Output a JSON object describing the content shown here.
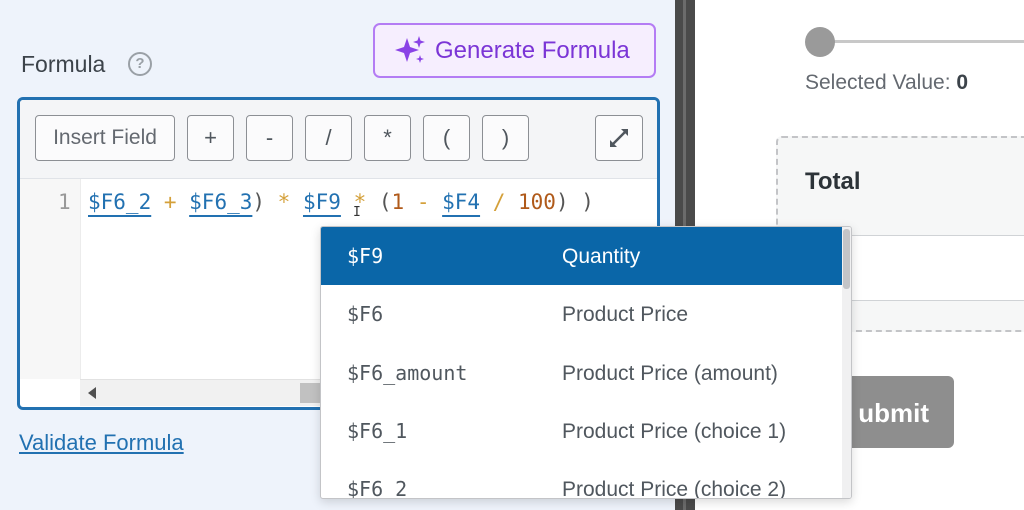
{
  "formula": {
    "label": "Formula",
    "help_icon": "question-circle-icon",
    "generate_button_label": "Generate Formula",
    "generate_icon": "sparkle-icon",
    "validate_link": "Validate Formula"
  },
  "toolbar": {
    "insert_field": "Insert Field",
    "plus": "+",
    "minus": "-",
    "divide": "/",
    "multiply": "*",
    "open_paren": "(",
    "close_paren": ")",
    "expand_icon": "expand-arrows-icon"
  },
  "editor": {
    "line_number": "1",
    "tokens": {
      "t1": "$F6_2",
      "t2": " + ",
      "t3": "$F6_3",
      "t4": ") ",
      "t5": "*",
      "t6": " ",
      "t7": "$F9",
      "t8": " ",
      "t9": "*",
      "t10": " (",
      "t11": "1",
      "t12": " - ",
      "t13": "$F4",
      "t14": " / ",
      "t15": "100",
      "t16": ") )"
    }
  },
  "dropdown": {
    "items": [
      {
        "code": "$F9",
        "name": "Quantity"
      },
      {
        "code": "$F6",
        "name": "Product Price"
      },
      {
        "code": "$F6_amount",
        "name": "Product Price (amount)"
      },
      {
        "code": "$F6_1",
        "name": "Product Price (choice 1)"
      },
      {
        "code": "$F6_2",
        "name": "Product Price (choice 2)"
      }
    ],
    "active_index": 0
  },
  "preview": {
    "selected_value_label": "Selected Value:",
    "selected_value": "0",
    "slider_value": 0,
    "total_label": "Total",
    "submit_label": "ubmit"
  },
  "colors": {
    "accent": "#2271b1",
    "ai_purple": "#7b35d6",
    "active_row": "#0a66a8"
  }
}
